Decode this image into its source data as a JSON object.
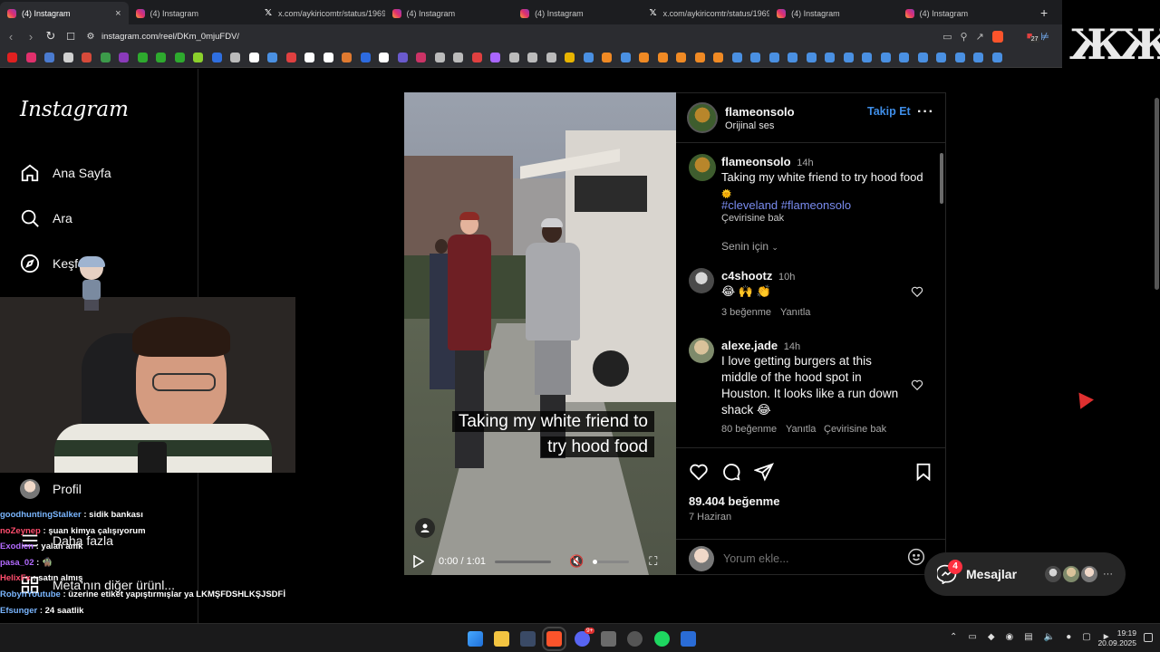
{
  "browser": {
    "tabs": [
      {
        "title": "(4) Instagram",
        "icon": "instagram-icon",
        "active": true
      },
      {
        "title": "(4) Instagram",
        "icon": "instagram-icon",
        "active": false
      },
      {
        "title": "x.com/aykiricomtr/status/1969…",
        "icon": "x-icon",
        "active": false
      },
      {
        "title": "(4) Instagram",
        "icon": "instagram-icon",
        "active": false
      },
      {
        "title": "(4) Instagram",
        "icon": "instagram-icon",
        "active": false
      },
      {
        "title": "x.com/aykiricomtr/status/1969…",
        "icon": "x-icon",
        "active": false
      },
      {
        "title": "(4) Instagram",
        "icon": "instagram-icon",
        "active": false
      },
      {
        "title": "(4) Instagram",
        "icon": "instagram-icon",
        "active": false
      }
    ],
    "close_glyph": "×",
    "new_tab_glyph": "+",
    "url": "instagram.com/reel/DKm_0mjuFDV/",
    "extension_badge": "27",
    "bookmark_colors": [
      "#e02020",
      "#e1306c",
      "#4a7bd0",
      "#d0d0d0",
      "#d64a3a",
      "#3c9a4a",
      "#8a3ab9",
      "#2eaa2e",
      "#2eaa2e",
      "#2eaa2e",
      "#8bd12c",
      "#2f6fe0",
      "#bbbbbb",
      "#ffffff",
      "#4a90e2",
      "#e04040",
      "#ffffff",
      "#ffffff",
      "#e07a30",
      "#2d6be0",
      "#ffffff",
      "#6a5acd",
      "#cc3366",
      "#bbbbbb",
      "#bbbbbb",
      "#e04040",
      "#aa66ff",
      "#bbbbbb",
      "#bbbbbb",
      "#bbbbbb",
      "#e8b400",
      "#4a90e2",
      "#f08a24",
      "#4a90e2",
      "#f08a24",
      "#f08a24",
      "#f08a24",
      "#f08a24",
      "#f08a24",
      "#4a90e2",
      "#4a90e2",
      "#4a90e2",
      "#4a90e2",
      "#4a90e2",
      "#4a90e2",
      "#4a90e2",
      "#4a90e2",
      "#4a90e2",
      "#4a90e2",
      "#4a90e2",
      "#4a90e2",
      "#4a90e2",
      "#4a90e2",
      "#4a90e2"
    ]
  },
  "stream_logo": "ЖЖ",
  "instagram": {
    "logo": "Instagram",
    "nav": [
      {
        "key": "home",
        "label": "Ana Sayfa",
        "icon": "home-icon"
      },
      {
        "key": "search",
        "label": "Ara",
        "icon": "search-icon"
      },
      {
        "key": "explore",
        "label": "Keşfet",
        "icon": "compass-icon"
      },
      {
        "key": "profile",
        "label": "Profil",
        "icon": "avatar"
      },
      {
        "key": "more",
        "label": "Daha fazla",
        "icon": "menu-icon"
      },
      {
        "key": "meta",
        "label": "Meta'nın diğer ürünl...",
        "icon": "grid-icon"
      }
    ],
    "video": {
      "caption_line1": "Taking my white friend to",
      "caption_line2": "try hood food",
      "time": "0:00 / 1:01"
    },
    "post": {
      "owner": "flameonsolo",
      "audio": "Orijinal ses",
      "follow_label": "Takip Et",
      "caption_user": "flameonsolo",
      "caption_age": "14h",
      "caption_text": "Taking my white friend to try hood food",
      "caption_emoji": "🌞",
      "hashtags": "#cleveland #flameonsolo",
      "see_translation": "Çevirisine bak",
      "for_you": "Senin için",
      "comments": [
        {
          "user": "c4shootz",
          "age": "10h",
          "text": "😂 🙌 👏",
          "likes": "3 beğenme",
          "reply": "Yanıtla"
        },
        {
          "user": "alexe.jade",
          "age": "14h",
          "text": "I love getting burgers at this middle of the hood spot in Houston. It looks like a run down shack 😂",
          "likes": "80 beğenme",
          "reply": "Yanıtla",
          "translate": "Çevirisine bak"
        }
      ],
      "likes_count": "89.404 beğenme",
      "date": "7 Haziran",
      "comment_placeholder": "Yorum ekle..."
    },
    "messages": {
      "label": "Mesajlar",
      "badge": "4",
      "more_glyph": "···"
    }
  },
  "chat": [
    {
      "user": "goodhuntingStalker",
      "color": "#7ab6ff",
      "text": "sidik bankası"
    },
    {
      "user": "noZeynep",
      "color": "#ff4d6d",
      "text": "şuan kimya çalışıyorum"
    },
    {
      "user": "Exodien",
      "color": "#b36bff",
      "text": "yalan amk"
    },
    {
      "user": "pasa_02",
      "color": "#b36bff",
      "text": "🧌"
    },
    {
      "user": "HelixFx",
      "color": "#ff4d6d",
      "text": "satın almış"
    },
    {
      "user": "RobynYoutube",
      "color": "#7ab6ff",
      "text": "üzerine etiket yapıştırmışlar ya LKMŞFDSHLKŞJSDFİ"
    },
    {
      "user": "Efsunger",
      "color": "#7ab6ff",
      "text": "24 saatlik"
    }
  ],
  "taskbar": {
    "time": "19:19",
    "date": "20.09.2025",
    "discord_badge": "9+"
  }
}
